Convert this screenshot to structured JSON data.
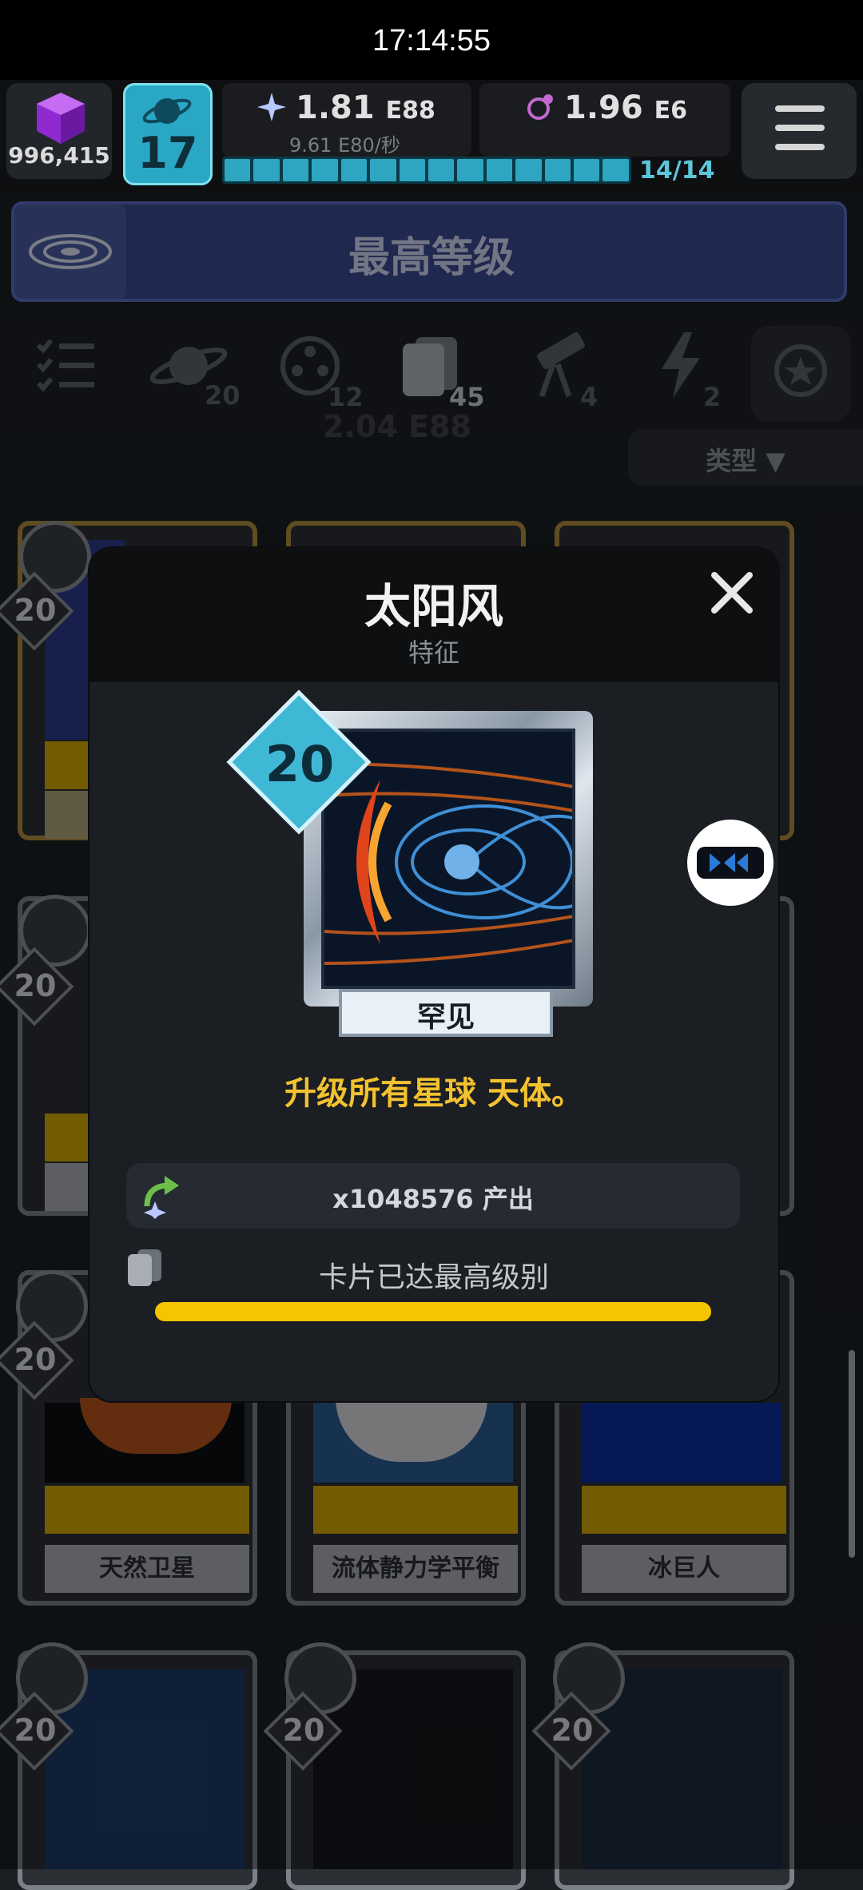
{
  "status_bar": {
    "time": "17:14:55"
  },
  "hud": {
    "gems": "996,415",
    "level": "17",
    "stardust": {
      "value": "1.81",
      "exp": "E88",
      "rate": "9.61",
      "rate_exp": "E80",
      "rate_unit": "/秒"
    },
    "dark_matter": {
      "value": "1.96",
      "exp": "E6"
    },
    "progress_label": "14/14",
    "progress_segments": 14
  },
  "banner": {
    "title": "最高等级"
  },
  "tabs": [
    {
      "icon": "checklist-icon",
      "count": ""
    },
    {
      "icon": "planet-icon",
      "count": "20"
    },
    {
      "icon": "film-reel-icon",
      "count": "12"
    },
    {
      "icon": "cards-icon",
      "count": "45"
    },
    {
      "icon": "telescope-icon",
      "count": "4"
    },
    {
      "icon": "lightning-icon",
      "count": "2"
    },
    {
      "icon": "medal-icon",
      "count": ""
    }
  ],
  "tab_overlay_text": "2.04 E88",
  "filter": {
    "type_label": "类型 ▼"
  },
  "background_cards": {
    "level": "20",
    "row3_names": [
      "天然卫星",
      "流体静力学平衡",
      "冰巨人"
    ]
  },
  "modal": {
    "title": "太阳风",
    "subtitle": "特征",
    "card_level": "20",
    "rarity": "罕见",
    "description": "升级所有星球 天体。",
    "output": "x1048576 产出",
    "maxed": "卡片已达最高级别",
    "progress": 1.0
  },
  "colors": {
    "accent_yellow": "#f6c400",
    "level_blue": "#2aa7c4",
    "banner_blue": "#3a4a8e"
  }
}
